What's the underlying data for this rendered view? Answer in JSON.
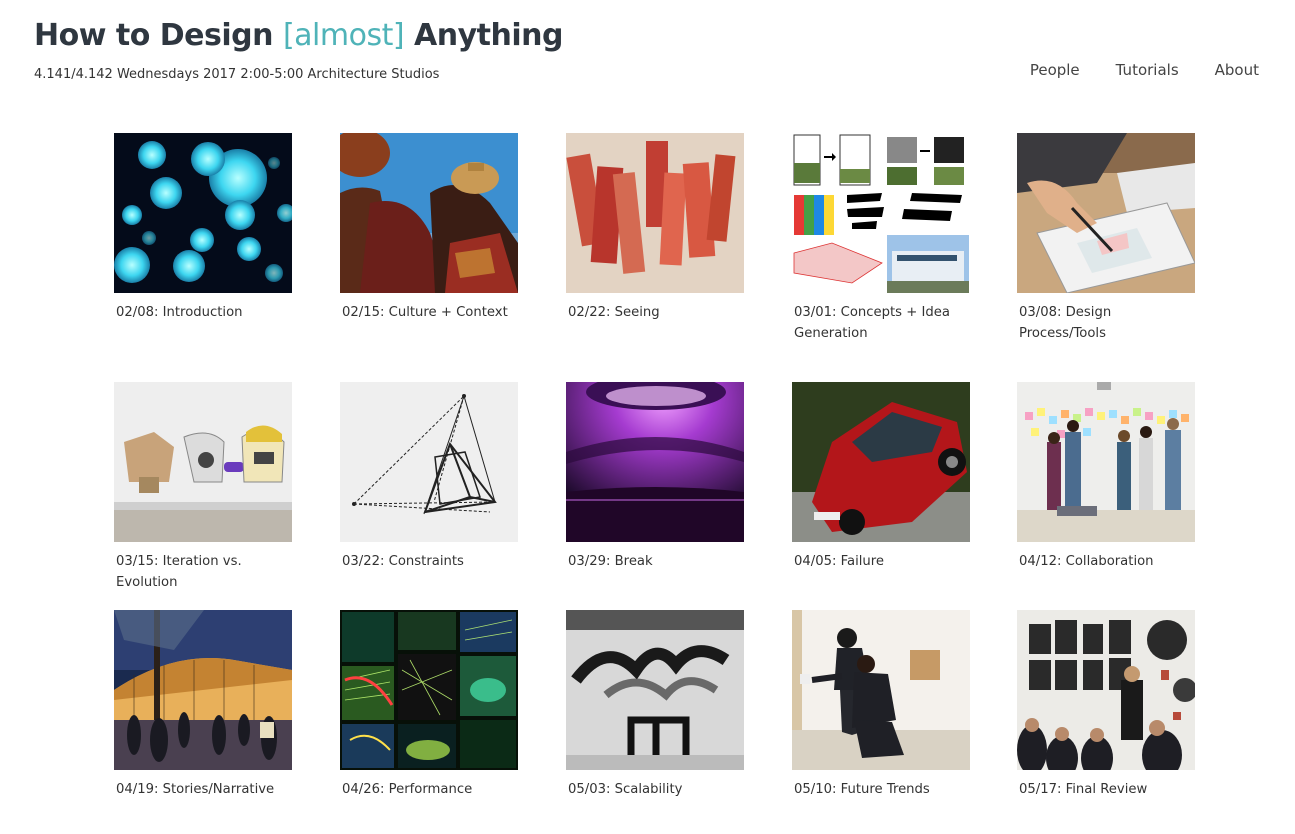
{
  "header": {
    "title_pre": "How to Design ",
    "title_accent": "[almost]",
    "title_post": " Anything",
    "subtitle": "4.141/4.142 Wednesdays 2017 2:00-5:00 Architecture Studios"
  },
  "nav": [
    {
      "label": "People"
    },
    {
      "label": "Tutorials"
    },
    {
      "label": "About"
    }
  ],
  "sessions": [
    {
      "label": "02/08: Introduction",
      "image": "blue-glowing-spheres"
    },
    {
      "label": "02/15: Culture + Context",
      "image": "woman-carrying-pots"
    },
    {
      "label": "02/22: Seeing",
      "image": "red-paper-strips"
    },
    {
      "label": "03/01: Concepts + Idea Generation",
      "image": "concept-diagram-collage"
    },
    {
      "label": "03/08: Design Process/Tools",
      "image": "drawing-on-tablet"
    },
    {
      "label": "03/15: Iteration vs. Evolution",
      "image": "robot-head-prototypes"
    },
    {
      "label": "03/22: Constraints",
      "image": "perspective-wireframe-drawing"
    },
    {
      "label": "03/29: Break",
      "image": "purple-light-atrium"
    },
    {
      "label": "04/05: Failure",
      "image": "red-car-tipping"
    },
    {
      "label": "04/12: Collaboration",
      "image": "team-at-sticky-note-wall"
    },
    {
      "label": "04/19: Stories/Narrative",
      "image": "night-plaza-rendering"
    },
    {
      "label": "04/26: Performance",
      "image": "colorful-simulation-grid"
    },
    {
      "label": "05/03: Scalability",
      "image": "black-tube-sculpture"
    },
    {
      "label": "05/10: Future Trends",
      "image": "men-inspecting-wall"
    },
    {
      "label": "05/17: Final Review",
      "image": "review-crowd-with-posters"
    }
  ]
}
